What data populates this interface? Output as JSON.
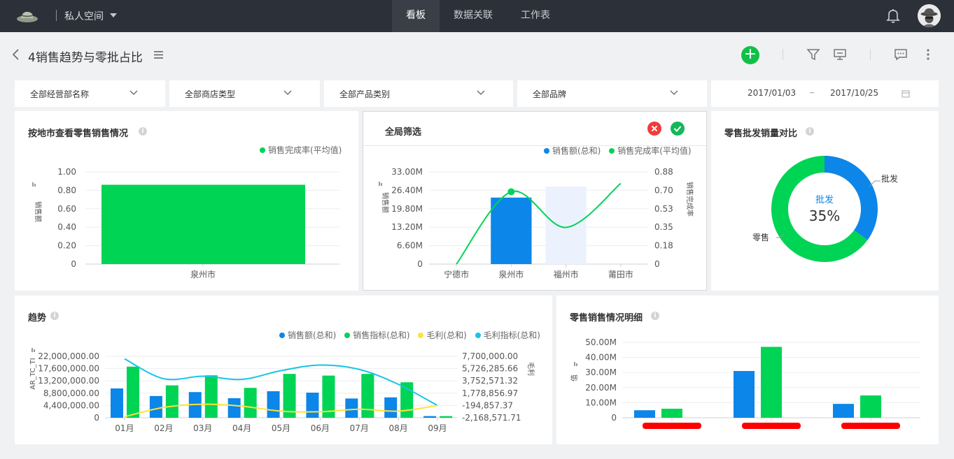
{
  "colors": {
    "topbar": "#2c3038",
    "green": "#00d455",
    "blue": "#0c86e8",
    "yellow": "#ffe23a",
    "cyan": "#15c6e6",
    "accent_button": "#0ec146",
    "red": "#f23a3a"
  },
  "header": {
    "space_name": "私人空间",
    "tabs": [
      {
        "label": "看板",
        "active": true
      },
      {
        "label": "数据关联",
        "active": false
      },
      {
        "label": "工作表",
        "active": false
      }
    ]
  },
  "titlebar": {
    "title": "4销售趋势与零批占比"
  },
  "filters": {
    "items": [
      {
        "label": "全部经营部名称"
      },
      {
        "label": "全部商店类型"
      },
      {
        "label": "全部产品类别"
      },
      {
        "label": "全部品牌"
      }
    ],
    "date_start": "2017/01/03",
    "date_sep": "~",
    "date_end": "2017/10/25"
  },
  "card_city": {
    "title": "按地市查看零售销售情况",
    "legend": [
      {
        "label": "销售完成率(平均值)",
        "color": "#00d455"
      }
    ],
    "y_axis_label": "销售额",
    "y_ticks": [
      "1.00",
      "0.80",
      "0.60",
      "0.40",
      "0.20",
      "0"
    ],
    "x_ticks": [
      "泉州市"
    ]
  },
  "card_global": {
    "title": "全局筛选",
    "legend": [
      {
        "label": "销售额(总和)",
        "color": "#0c86e8"
      },
      {
        "label": "销售完成率(平均值)",
        "color": "#00d455"
      }
    ],
    "y_axis_label": "销售额",
    "y2_axis_label": "销售完成率",
    "y_ticks": [
      "33.00M",
      "26.40M",
      "19.80M",
      "13.20M",
      "6.60M",
      "0"
    ],
    "y2_ticks": [
      "0.88",
      "0.70",
      "0.53",
      "0.35",
      "0.18",
      "0"
    ],
    "x_ticks": [
      "宁德市",
      "泉州市",
      "福州市",
      "莆田市"
    ]
  },
  "card_ratio": {
    "title": "零售批发销量对比",
    "center_label": "批发",
    "center_value": "35%",
    "labels": {
      "wholesale": "批发",
      "retail": "零售"
    }
  },
  "card_trend": {
    "title": "趋势",
    "legend": [
      {
        "label": "销售额(总和)",
        "color": "#0c86e8"
      },
      {
        "label": "销售指标(总和)",
        "color": "#00d455"
      },
      {
        "label": "毛利(总和)",
        "color": "#ffe23a"
      },
      {
        "label": "毛利指标(总和)",
        "color": "#15c6e6"
      }
    ],
    "y_axis_label": "AR_TC_TI",
    "y2_axis_label": "毛利",
    "y_ticks": [
      "22,000,000.00",
      "17,600,000.00",
      "13,200,000.00",
      "8,800,000.00",
      "4,400,000.00",
      "0"
    ],
    "y2_ticks": [
      "7,700,000.00",
      "5,726,285.66",
      "3,752,571.32",
      "1,778,856.97",
      "-194,857.37",
      "-2,168,571.71"
    ],
    "x_ticks": [
      "01月",
      "02月",
      "03月",
      "04月",
      "05月",
      "06月",
      "07月",
      "08月",
      "09月"
    ]
  },
  "card_detail": {
    "title": "零售销售情况明细",
    "y_axis_label": "值",
    "y_ticks": [
      "50.00M",
      "40.00M",
      "30.00M",
      "20.00M",
      "10.00M",
      "0"
    ]
  },
  "chart_data": [
    {
      "id": "city",
      "type": "bar",
      "title": "按地市查看零售销售情况",
      "categories": [
        "泉州市"
      ],
      "series": [
        {
          "name": "销售完成率(平均值)",
          "values": [
            0.86
          ]
        }
      ],
      "ylabel": "销售额",
      "ylim": [
        0,
        1.0
      ]
    },
    {
      "id": "global",
      "type": "bar",
      "title": "全局筛选",
      "categories": [
        "宁德市",
        "泉州市",
        "福州市",
        "莆田市"
      ],
      "series": [
        {
          "name": "销售额(总和)",
          "type": "bar",
          "values": [
            0,
            23800000,
            0,
            0
          ]
        },
        {
          "name": "销售完成率(平均值)",
          "type": "line",
          "axis": "right",
          "values": [
            0,
            0.69,
            0.35,
            0.77
          ]
        }
      ],
      "highlight_category": "福州市",
      "ylim": [
        0,
        33000000
      ],
      "y2lim": [
        0,
        0.88
      ]
    },
    {
      "id": "ratio",
      "type": "pie",
      "title": "零售批发销量对比",
      "categories": [
        "批发",
        "零售"
      ],
      "values": [
        35,
        65
      ]
    },
    {
      "id": "trend",
      "type": "bar",
      "title": "趋势",
      "categories": [
        "01月",
        "02月",
        "03月",
        "04月",
        "05月",
        "06月",
        "07月",
        "08月",
        "09月"
      ],
      "series": [
        {
          "name": "销售额(总和)",
          "type": "bar",
          "values": [
            10500000,
            7800000,
            9200000,
            7000000,
            9500000,
            9000000,
            6900000,
            7300000,
            600000
          ]
        },
        {
          "name": "销售指标(总和)",
          "type": "bar",
          "values": [
            18300000,
            11600000,
            15200000,
            10700000,
            15700000,
            15100000,
            15700000,
            12700000,
            600000
          ]
        },
        {
          "name": "毛利(总和)",
          "type": "line",
          "axis": "right",
          "values": [
            -2000000,
            -500000,
            0,
            -300000,
            -1100000,
            -1200000,
            -800000,
            -1100000,
            -200000
          ]
        },
        {
          "name": "毛利指标(总和)",
          "type": "line",
          "axis": "right",
          "values": [
            7300000,
            4100000,
            4500000,
            4000000,
            5400000,
            6300000,
            5600000,
            3200000,
            -200000
          ]
        }
      ],
      "ylim": [
        0,
        22000000
      ],
      "y2lim": [
        -2168571.71,
        7700000
      ]
    },
    {
      "id": "detail",
      "type": "bar",
      "title": "零售销售情况明细",
      "categories": [
        "",
        "",
        ""
      ],
      "series": [
        {
          "name": "",
          "values": [
            5000000,
            31000000,
            9200000
          ]
        },
        {
          "name": "",
          "values": [
            6000000,
            47000000,
            14800000
          ]
        }
      ],
      "ylabel": "值",
      "ylim": [
        0,
        50000000
      ]
    }
  ]
}
